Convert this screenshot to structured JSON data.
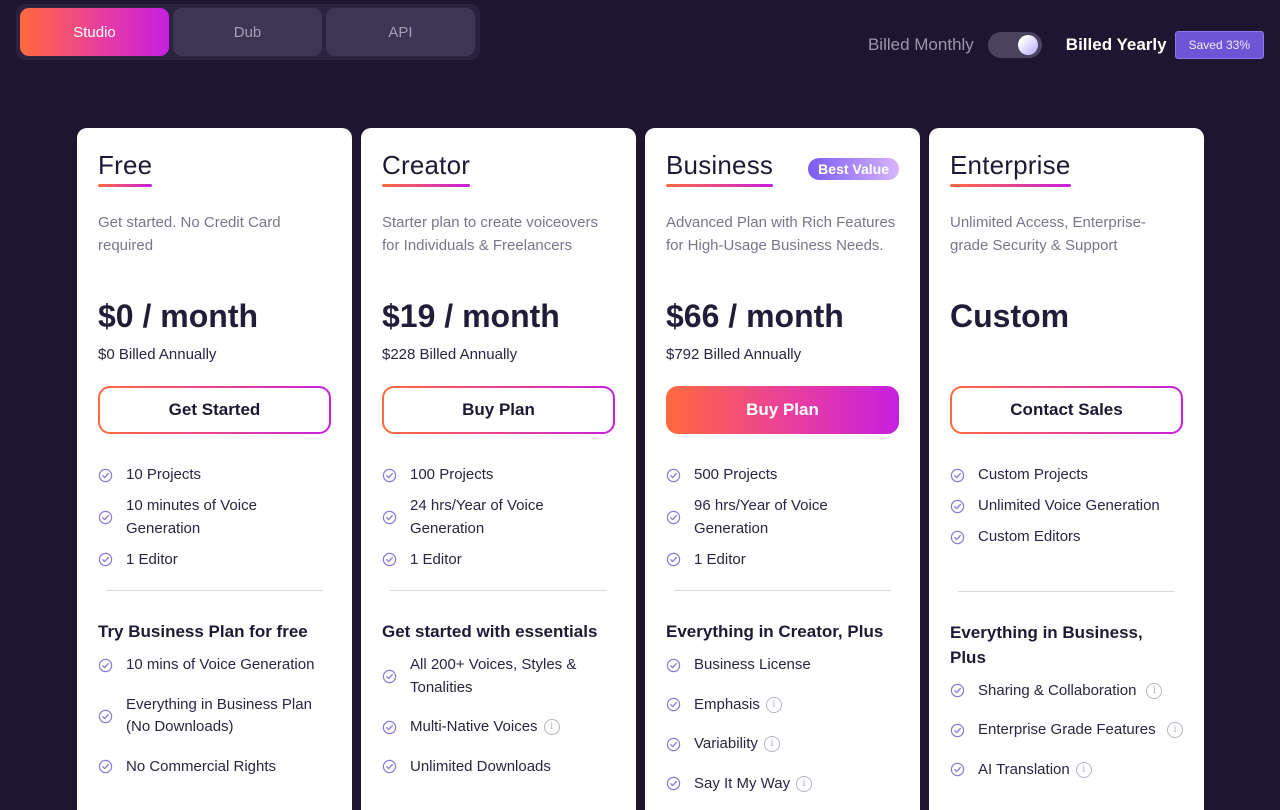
{
  "tabs": [
    {
      "label": "Studio",
      "active": true
    },
    {
      "label": "Dub",
      "active": false
    },
    {
      "label": "API",
      "active": false
    }
  ],
  "billing": {
    "monthly_label": "Billed Monthly",
    "yearly_label": "Billed Yearly",
    "saved_badge": "Saved 33%",
    "yearly_selected": true
  },
  "colors": {
    "background": "#1e1530",
    "accent_gradient_start": "#ff6a3d",
    "accent_gradient_end": "#c61fe0",
    "check_icon": "#8a7ad6"
  },
  "plans": [
    {
      "name": "Free",
      "description": "Get started. No Credit Card required",
      "price": "$0 / month",
      "billed": "$0 Billed Annually",
      "cta": "Get Started",
      "features": [
        "10 Projects",
        "10 minutes of Voice Generation",
        "1 Editor"
      ],
      "section_title": "Try Business Plan for free",
      "extras": [
        "10 mins of Voice Generation",
        "Everything in Business Plan (No Downloads)",
        "No Commercial Rights"
      ]
    },
    {
      "name": "Creator",
      "description": "Starter plan to create voiceovers for Individuals & Freelancers",
      "price": "$19 / month",
      "billed": "$228 Billed Annually",
      "cta": "Buy Plan",
      "features": [
        "100 Projects",
        "24 hrs/Year of Voice Generation",
        "1 Editor"
      ],
      "section_title": "Get started with essentials",
      "extras": [
        "All 200+ Voices, Styles & Tonalities",
        "Multi-Native Voices",
        "Unlimited Downloads"
      ]
    },
    {
      "name": "Business",
      "badge": "Best Value",
      "description": "Advanced Plan with Rich Features for High-Usage Business Needs.",
      "price": "$66 / month",
      "billed": "$792 Billed Annually",
      "cta": "Buy Plan",
      "features": [
        "500 Projects",
        "96 hrs/Year of Voice Generation",
        "1 Editor"
      ],
      "section_title": "Everything in Creator, Plus",
      "extras": [
        "Business License",
        "Emphasis",
        "Variability",
        "Say It My Way"
      ]
    },
    {
      "name": "Enterprise",
      "description": "Unlimited Access, Enterprise-grade Security & Support",
      "price": "Custom",
      "billed": "",
      "cta": "Contact Sales",
      "features": [
        "Custom Projects",
        "Unlimited Voice Generation",
        "Custom Editors"
      ],
      "section_title": "Everything in Business, Plus",
      "extras": [
        "Sharing & Collaboration",
        "Enterprise Grade Features",
        "AI Translation"
      ]
    }
  ],
  "icons": {
    "feature_check": "check-circle-icon",
    "info": "info-icon"
  }
}
